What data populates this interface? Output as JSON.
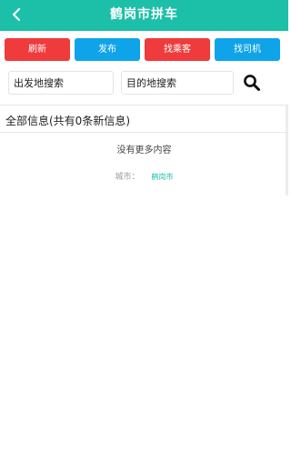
{
  "header": {
    "title": "鹤岗市拼车",
    "bg_color": "#1cbfa8",
    "back_icon": "chevron-left-icon"
  },
  "actions": [
    {
      "label": "刷新",
      "color": "#ef3b3b"
    },
    {
      "label": "发布",
      "color": "#0fa4e9"
    },
    {
      "label": "找乘客",
      "color": "#ef3b3b"
    },
    {
      "label": "找司机",
      "color": "#0fa4e9"
    }
  ],
  "search": {
    "origin_placeholder": "出发地搜索",
    "destination_placeholder": "目的地搜索",
    "icon": "search-icon"
  },
  "list": {
    "title": "全部信息(共有0条新信息)",
    "empty_text": "没有更多内容"
  },
  "city": {
    "label": "城市：",
    "value": "鹤岗市",
    "value_color": "#1cbfa8"
  }
}
